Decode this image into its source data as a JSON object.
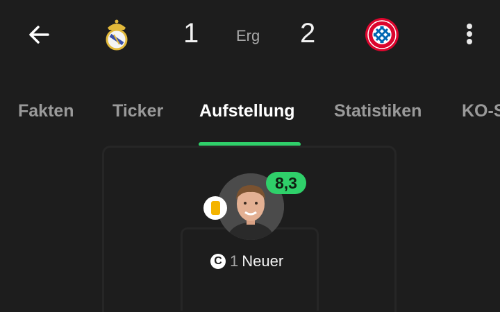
{
  "header": {
    "home_team": {
      "logo_icon": "real-madrid-crest-icon",
      "score": "1"
    },
    "status": "Erg",
    "away_team": {
      "logo_icon": "bayern-munchen-crest-icon",
      "score": "2"
    },
    "back_icon": "arrow-left-icon",
    "more_icon": "more-vertical-icon"
  },
  "tabs": [
    {
      "label": "Fakten"
    },
    {
      "label": "Ticker"
    },
    {
      "label": "Aufstellung",
      "active": true
    },
    {
      "label": "Statistiken"
    },
    {
      "label": "KO-S"
    }
  ],
  "lineup": {
    "goalkeeper": {
      "rating": "8,3",
      "number": "1",
      "name": "Neuer",
      "captain_mark": "C",
      "booking": "yellow-card-icon"
    }
  },
  "colors": {
    "background": "#1d1d1d",
    "accent_green": "#2fd06a",
    "yellow_card": "#f4b400"
  }
}
